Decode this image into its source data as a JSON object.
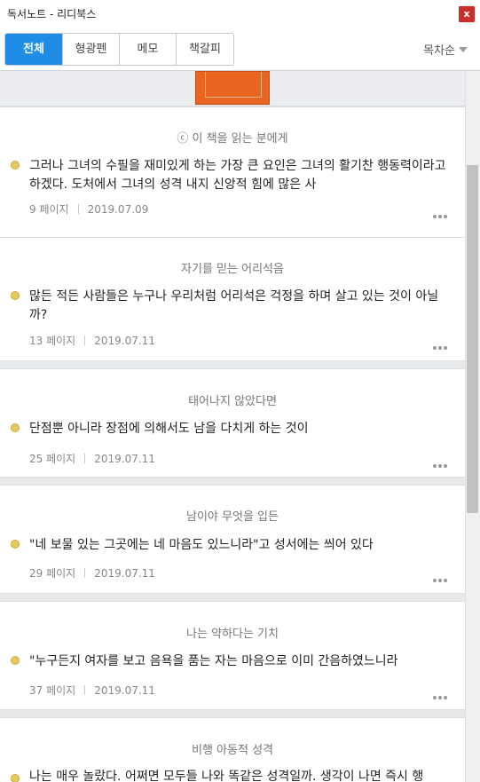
{
  "window": {
    "title": "독서노트 - 리디북스",
    "close_label": "x"
  },
  "tabs": [
    {
      "label": "전체",
      "active": true
    },
    {
      "label": "형광펜",
      "active": false
    },
    {
      "label": "메모",
      "active": false
    },
    {
      "label": "책갈피",
      "active": false
    }
  ],
  "sort": {
    "label": "목차순"
  },
  "cover": {
    "color": "#e8641f"
  },
  "notes": [
    {
      "chapter": "ⓒ 이 책을 읽는 분에게",
      "quote": "그러나 그녀의 수필을 재미있게 하는 가장 큰 요인은 그녀의 활기찬 행동력이라고 하겠다. 도처에서 그녀의 성격 내지 신앙적 힘에 많은 사",
      "page": "9 페이지",
      "date": "2019.07.09"
    },
    {
      "chapter": "자기를 믿는 어리석음",
      "quote": "많든 적든 사람들은 누구나 우리처럼 어리석은 걱정을 하며 살고 있는 것이 아닐까?",
      "page": "13 페이지",
      "date": "2019.07.11"
    },
    {
      "chapter": "태어나지 않았다면",
      "quote": "단점뿐 아니라 장점에 의해서도 남을 다치게 하는 것이",
      "page": "25 페이지",
      "date": "2019.07.11"
    },
    {
      "chapter": "남이야 무엇을 입든",
      "quote": "\"네 보물 있는 그곳에는 네 마음도 있느니라\"고 성서에는 씌어 있다",
      "page": "29 페이지",
      "date": "2019.07.11"
    },
    {
      "chapter": "나는 약하다는 기치",
      "quote": "\"누구든지 여자를 보고 음욕을 품는 자는 마음으로 이미 간음하였느니라",
      "page": "37 페이지",
      "date": "2019.07.11"
    },
    {
      "chapter": "비행 아동적 성격",
      "quote": "나는 매우 놀랐다. 어쩌면 모두들 나와 똑같은 성격일까. 생각이 나면 즉시 행",
      "page": "",
      "date": ""
    }
  ]
}
